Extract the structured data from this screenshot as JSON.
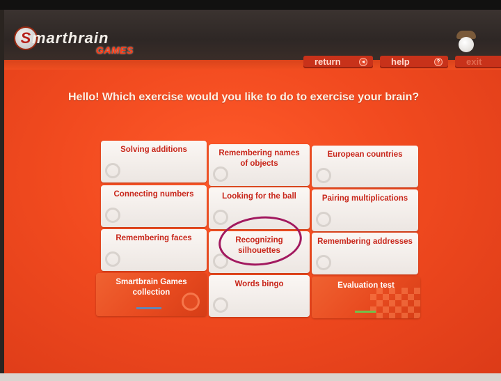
{
  "header": {
    "logo_s": "S",
    "logo_word": "marthrain",
    "logo_games": "GAMES"
  },
  "nav": {
    "return_label": "return",
    "help_label": "help",
    "exit_label": "exit"
  },
  "headline": "Hello!  Which exercise would you like to do to exercise your brain?",
  "tiles": [
    {
      "label": "Solving additions"
    },
    {
      "label": "Remembering names of objects"
    },
    {
      "label": "European countries"
    },
    {
      "label": "Connecting numbers"
    },
    {
      "label": "Looking for the ball"
    },
    {
      "label": "Pairing multiplications"
    },
    {
      "label": "Remembering faces"
    },
    {
      "label": "Recognizing silhouettes"
    },
    {
      "label": "Remembering addresses"
    },
    {
      "label": "Smartbrain Games collection"
    },
    {
      "label": "Words bingo"
    },
    {
      "label": "Evaluation test"
    }
  ],
  "colors": {
    "background": "#f14a1f",
    "tile_text": "#c8261a",
    "annotation": "#a2195f"
  }
}
